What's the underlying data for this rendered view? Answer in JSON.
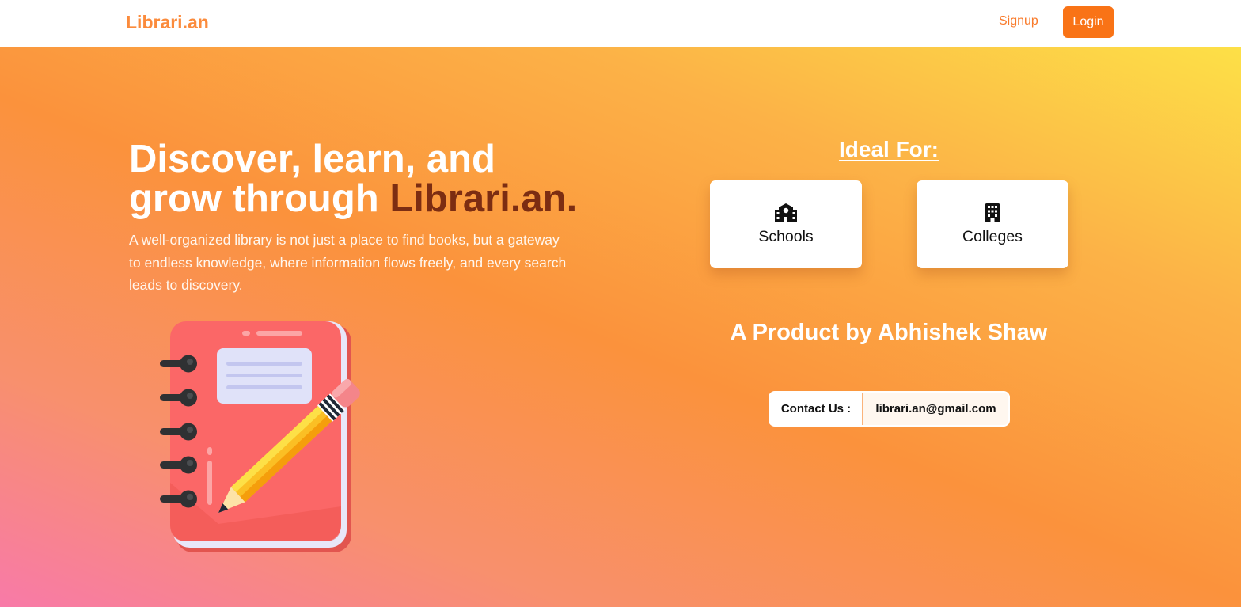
{
  "navbar": {
    "brand": "Librari.an",
    "signup_label": "Signup",
    "login_label": "Login"
  },
  "hero": {
    "headline_line1": "Discover, learn, and",
    "headline_line2_prefix": "grow through ",
    "headline_brand": "Librari.an.",
    "tagline": "A well-organized library is not just a place to find books, but a gateway to endless knowledge, where information flows freely, and every search leads to discovery.",
    "illustration_icon": "notebook-pencil-illustration"
  },
  "ideal_for": {
    "title": "Ideal For:",
    "cards": [
      {
        "label": "Schools",
        "icon": "school-icon"
      },
      {
        "label": "Colleges",
        "icon": "building-icon"
      }
    ]
  },
  "byline": "A Product by Abhishek Shaw",
  "contact": {
    "label": "Contact Us :",
    "email": "librari.an@gmail.com"
  },
  "colors": {
    "brand_orange": "#f97316",
    "brand_text": "#fb8b3c",
    "accent_brown": "#7c2d12",
    "gradient_pink": "#f87aa8",
    "gradient_orange": "#fb923c",
    "gradient_yellow": "#fde047"
  }
}
